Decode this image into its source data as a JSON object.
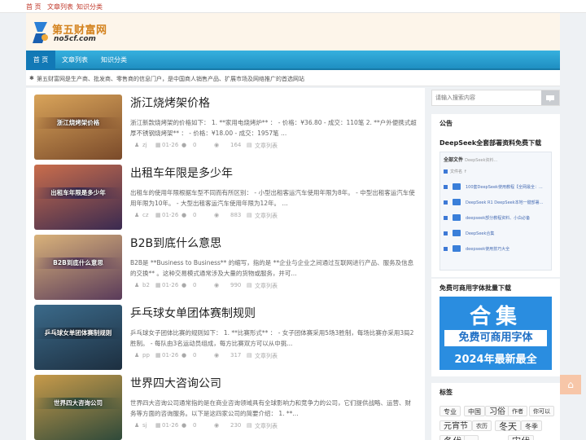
{
  "topnav": [
    "首 页",
    "文章列表",
    "知识分类"
  ],
  "logo": {
    "title": "第五财富网",
    "sub": "no5cf.com"
  },
  "nav": [
    "首 页",
    "文章列表",
    "知识分类"
  ],
  "notice": "第五财富网是生产商、批发商、零售商的信息门户，是中国商人销售产品、扩展市场及网络推广的首选网站",
  "posts": [
    {
      "thumb_text": "浙江烧烤架价格",
      "title": "浙江烧烤架价格",
      "desc": "浙江新款烧烤架的价格如下： 1. **家用电烧烤炉** ： - 价格：¥36.80 - 成交：110笔 2. **户外便携式超厚不锈钢烧烤架** ： - 价格：¥18.00 - 成交：1957笔 ...",
      "author": "zj",
      "date": "01-26",
      "comments": "0",
      "views": "164",
      "category": "文章列表",
      "colors": [
        "#d9a45a",
        "#7a4a2a"
      ]
    },
    {
      "thumb_text": "出租车年限是多少年",
      "title": "出租车年限是多少年",
      "desc": "出租车的使用年限根据车型不同而有所区别： - 小型出租客运汽车使用年限为8年。 - 中型出租客运汽车使用年限为10年。 - 大型出租客运汽车使用年限为12年。 ...",
      "author": "cz",
      "date": "01-26",
      "comments": "0",
      "views": "883",
      "category": "文章列表",
      "colors": [
        "#c96d4c",
        "#3a2a50"
      ]
    },
    {
      "thumb_text": "B2B到底什么意思",
      "title": "B2B到底什么意思",
      "desc": "B2B是 **Business to Business** 的缩写，指的是 **企业与企业之间通过互联网进行产品、服务及信息的交换** 。这种交易模式通常涉及大量的货物或服务，并可...",
      "author": "b2",
      "date": "01-26",
      "comments": "0",
      "views": "990",
      "category": "文章列表",
      "colors": [
        "#d9b27a",
        "#5a3b5a"
      ]
    },
    {
      "thumb_text": "乒乓球女单团体赛制规则",
      "title": "乒乓球女单团体赛制规则",
      "desc": "乒乓球女子团体比赛的规则如下： 1. **比赛形式** ： - 女子团体赛采用5场3胜制，每场比赛亦采用3局2胜制。 - 每队由3名运动员组成，每方比赛双方可以从中挑...",
      "author": "pp",
      "date": "01-26",
      "comments": "0",
      "views": "317",
      "category": "文章列表",
      "colors": [
        "#3b6a8a",
        "#1d2f40"
      ]
    },
    {
      "thumb_text": "世界四大咨询公司",
      "title": "世界四大咨询公司",
      "desc": "世界四大咨询公司通常指的是在商业咨询领域具有全球影响力和竞争力的公司，它们提供战略、运营、财务等方面的咨询服务。以下是这四家公司的简要介绍： 1. **...",
      "author": "sj",
      "date": "01-26",
      "comments": "0",
      "views": "230",
      "category": "文章列表",
      "colors": [
        "#c79a4a",
        "#2f4a3a"
      ]
    }
  ],
  "search": {
    "placeholder": "请输入搜索内容"
  },
  "announce": {
    "heading": "公告",
    "title": "DeepSeek全套部署资料免费下载",
    "box_head": "全部文件",
    "box_head_sub": "DeepSeek资料...",
    "rows": [
      "文件名 ↑",
      "100套DeepSeek使用教程【全网最全：...",
      "DeepSeek R1 DeepSeek本地一键部署...",
      "deepseek部分教程资料、小白必备",
      "DeepSeek合集",
      "deepseek使用技巧大全"
    ]
  },
  "fonts": {
    "heading": "免费可商用字体批量下载",
    "big": "合集",
    "line1": "免费可商用字体",
    "line2": "2024年最新最全"
  },
  "tags": {
    "heading": "标签",
    "items": [
      "专业",
      "中国",
      "习俗",
      "作者",
      "你可以",
      "元宵节",
      "农历",
      "冬天",
      "冬季",
      "冬代",
      "...",
      "宋代"
    ]
  },
  "back_to_top": "⌂"
}
